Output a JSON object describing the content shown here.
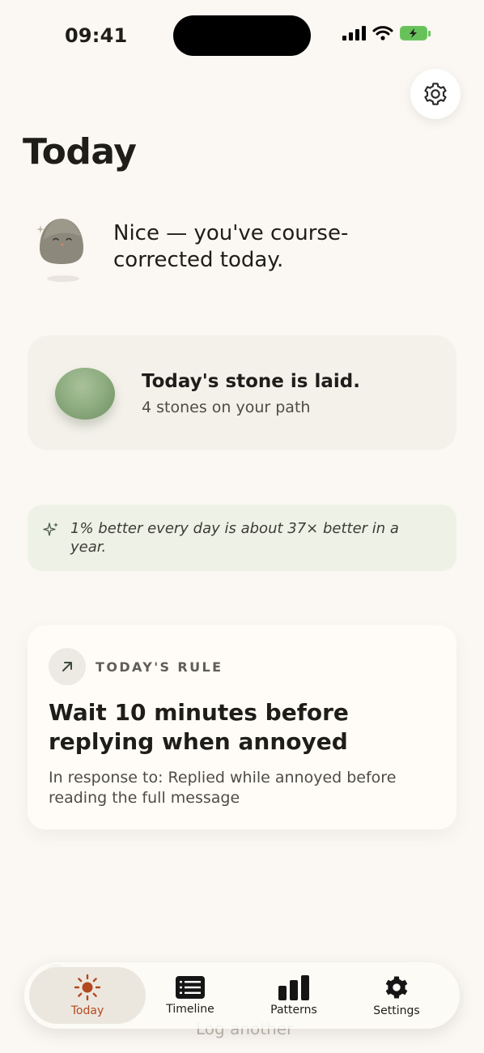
{
  "status_bar": {
    "time": "09:41"
  },
  "header": {
    "title": "Today"
  },
  "greeting": {
    "text": "Nice — you've course-corrected today."
  },
  "stone": {
    "title": "Today's stone is laid.",
    "subtitle": "4 stones on your path"
  },
  "quote": {
    "text": "1% better every day is about 37× better in a year."
  },
  "rule": {
    "label": "TODAY'S RULE",
    "title": "Wait 10 minutes before replying when annoyed",
    "response": "In response to: Replied while annoyed before reading the full message"
  },
  "background": {
    "log_another": "Log another"
  },
  "tabs": [
    {
      "label": "Today",
      "icon": "sun-icon",
      "active": true
    },
    {
      "label": "Timeline",
      "icon": "list-icon",
      "active": false
    },
    {
      "label": "Patterns",
      "icon": "bar-chart-icon",
      "active": false
    },
    {
      "label": "Settings",
      "icon": "gear-icon",
      "active": false
    }
  ],
  "colors": {
    "background": "#fbf8f3",
    "accent": "#b3481f",
    "stone_green": "#8fae82",
    "quote_bg": "#eef2e6",
    "battery_green": "#67c15b"
  }
}
